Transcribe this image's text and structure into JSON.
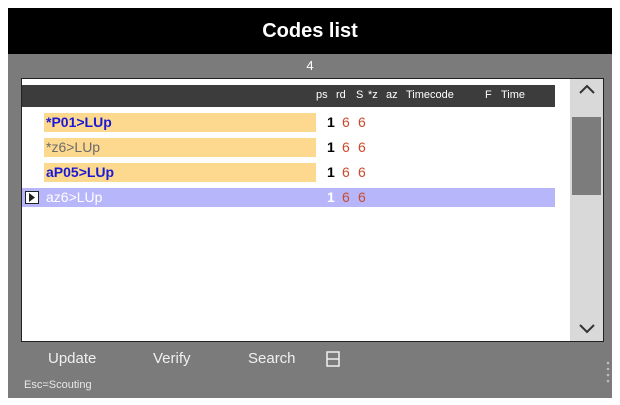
{
  "window": {
    "title": "Codes list",
    "count": "4"
  },
  "columns": [
    "ps",
    "rd",
    "S",
    "*z",
    "az",
    "Timecode",
    "F",
    "Time"
  ],
  "rows": [
    {
      "code": "*P01>LUp",
      "col1": "1",
      "col2": "6",
      "col3": "6",
      "bg": "#fcd98f",
      "color": "#1a1ad6",
      "bold": true,
      "selected": false
    },
    {
      "code": "*z6>LUp",
      "col1": "1",
      "col2": "6",
      "col3": "6",
      "bg": "#fcd98f",
      "color": "#6b6b6b",
      "bold": false,
      "selected": false
    },
    {
      "code": "aP05>LUp",
      "col1": "1",
      "col2": "6",
      "col3": "6",
      "bg": "#fcd98f",
      "color": "#1a1ad6",
      "bold": true,
      "selected": false
    },
    {
      "code": "az6>LUp",
      "col1": "1",
      "col2": "6",
      "col3": "6",
      "bg": "#b8b6fb",
      "color": "#ffffff",
      "bold": false,
      "selected": true
    }
  ],
  "footer": {
    "update_label": "Update",
    "verify_label": "Verify",
    "search_label": "Search",
    "hint": "Esc=Scouting"
  },
  "icons": {
    "scroll_up": "chevron-up-icon",
    "scroll_down": "chevron-down-icon",
    "row_pointer": "triangle-right-icon",
    "list_menu": "list-menu-icon",
    "resize_grip": "resize-grip-icon"
  },
  "colors": {
    "title_bar": "#000000",
    "panel": "#7b7b7b",
    "header": "#3c3c3c",
    "value_red": "#c94a2b"
  }
}
